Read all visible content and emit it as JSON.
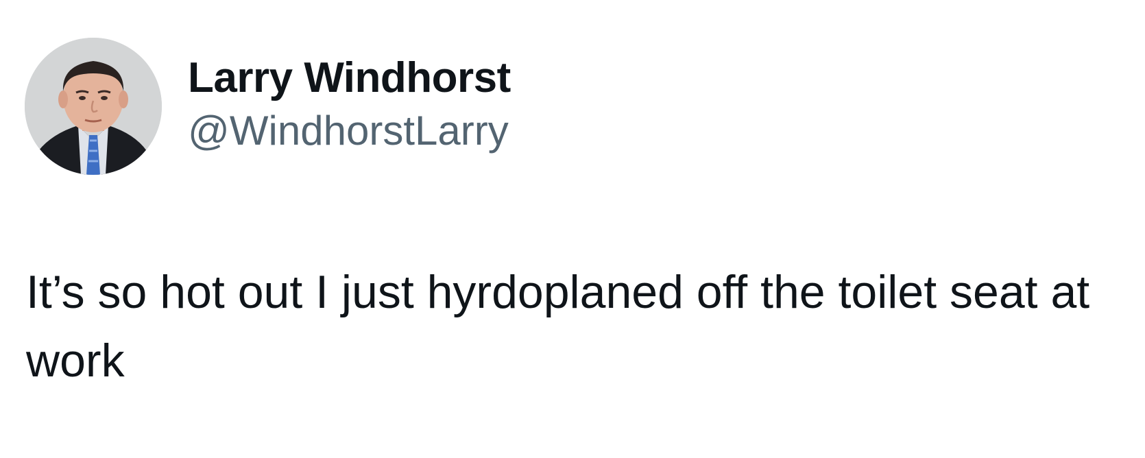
{
  "author": {
    "display_name": "Larry Windhorst",
    "handle": "@WindhorstLarry"
  },
  "tweet": {
    "text": "It’s so hot out I just hyrdoplaned off the toilet seat at work"
  },
  "colors": {
    "name": "#0f1419",
    "handle": "#536471",
    "background": "#ffffff"
  }
}
